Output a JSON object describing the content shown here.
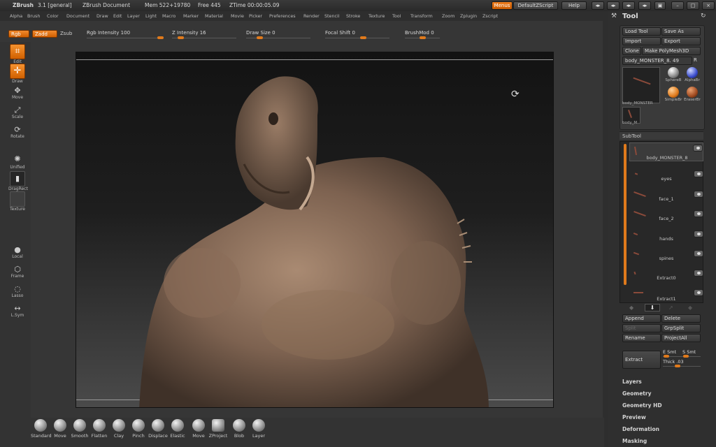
{
  "titlebar": {
    "app": "ZBrush",
    "version": "3.1 [general]",
    "document": "ZBrush Document",
    "mem": "Mem 522+19780",
    "free": "Free 445",
    "ztime": "ZTime 00:00:05.09",
    "menus_btn": "Menus",
    "zscript_btn": "DefaultZScript",
    "help_btn": "Help"
  },
  "menubar": [
    "Alpha",
    "Brush",
    "Color",
    "Document",
    "Draw",
    "Edit",
    "Layer",
    "Light",
    "Macro",
    "Marker",
    "Material",
    "Movie",
    "Picker",
    "Preferences",
    "Render",
    "Stencil",
    "Stroke",
    "Texture",
    "Tool",
    "Transform",
    "Zoom",
    "Zplugin",
    "Zscript"
  ],
  "shelf": {
    "rgb": "Rgb",
    "zadd": "Zadd",
    "zsub": "Zsub",
    "rgb_intensity": "Rgb Intensity 100",
    "z_intensity": "Z Intensity 16",
    "draw_size": "Draw Size 0",
    "focal_shift": "Focal Shift 0",
    "brushmod": "BrushMod 0"
  },
  "lefttools": {
    "edit": "Edit",
    "draw": "Draw",
    "move": "Move",
    "scale": "Scale",
    "rotate": "Rotate",
    "unified": "Unified",
    "dragrect": "DragRect",
    "texture": "Texture",
    "local": "Local",
    "frame": "Frame",
    "lasso": "Lasso",
    "lsym": "L.Sym"
  },
  "brushes": [
    "Standard",
    "Move",
    "Smooth",
    "Flatten",
    "Clay",
    "Pinch",
    "Displace",
    "Elastic",
    "Move",
    "ZProject",
    "Blob",
    "Layer"
  ],
  "toolpanel": {
    "title": "Tool",
    "load_tool": "Load Tool",
    "save_as": "Save As",
    "import": "Import",
    "export": "Export",
    "clone": "Clone",
    "make_polymesh": "Make PolyMesh3D",
    "current_tool": "body_MONSTER_8. 49",
    "r": "R",
    "thumb_main_label": "body_MONSTER",
    "thumb_small_label": "body_M",
    "tools": [
      "SphereB",
      "AlphaBr",
      "SimpleBr",
      "EraserBr"
    ]
  },
  "subtool": {
    "header": "SubTool",
    "items": [
      "body_MONSTER_8",
      "eyes",
      "face_1",
      "face_2",
      "hands",
      "spines",
      "Extract0",
      "Extract1"
    ],
    "append": "Append",
    "delete": "Delete",
    "split": "Split",
    "grpsplit": "GrpSplit",
    "rename": "Rename",
    "projectall": "ProjectAll",
    "extract": "Extract",
    "e_smt": "E Smt",
    "s_smt": "S Smt",
    "thick": "Thick .03"
  },
  "sections": [
    "Layers",
    "Geometry",
    "Geometry HD",
    "Preview",
    "Deformation",
    "Masking"
  ],
  "colors": {
    "accent": "#e0781a",
    "panel": "#2f2f2f"
  }
}
